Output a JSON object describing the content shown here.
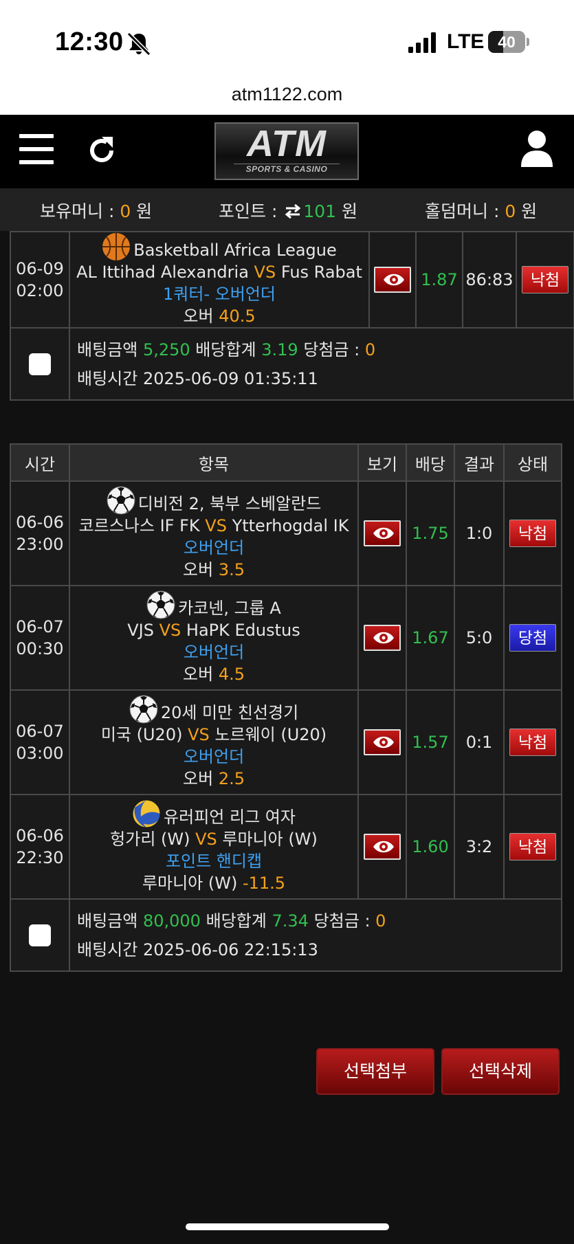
{
  "status_bar": {
    "time": "12:30",
    "network": "LTE",
    "battery": "40",
    "battery_level": 0.4
  },
  "browser": {
    "url": "atm1122.com"
  },
  "header": {
    "logo_main": "ATM",
    "logo_sub": "SPORTS & CASINO"
  },
  "balance": {
    "money_label": "보유머니 : ",
    "money_value": "0",
    "money_unit": " 원",
    "point_label": "포인트 : ",
    "point_value": "101",
    "point_unit": " 원",
    "holdem_label": "홀덤머니 : ",
    "holdem_value": "0",
    "holdem_unit": " 원"
  },
  "slip1": {
    "rows": [
      {
        "date": "06-09",
        "time": "02:00",
        "sport_icon": "basketball-icon",
        "league": "Basketball Africa League",
        "home": "AL Ittihad Alexandria",
        "vs": "VS",
        "away": "Fus Rabat",
        "market": "1쿼터- 오버언더",
        "pick": "오버",
        "line": "40.5",
        "odds": "1.87",
        "result": "86:83",
        "status": "낙첨"
      }
    ],
    "summary": {
      "amount_label": "배팅금액 ",
      "amount": "5,250",
      "total_label": " 배당합계 ",
      "total": "3.19",
      "payout_label": " 당첨금 : ",
      "payout": "0",
      "time_label": "배팅시간 ",
      "time": "2025-06-09 01:35:11"
    }
  },
  "slip2": {
    "headers": [
      "시간",
      "항목",
      "보기",
      "배당",
      "결과",
      "상태"
    ],
    "rows": [
      {
        "date": "06-06",
        "time": "23:00",
        "sport_icon": "soccer-ball-icon",
        "league": "디비전 2, 북부 스베알란드",
        "home": "코르스나스 IF FK",
        "vs": "VS",
        "away": "Ytterhogdal IK",
        "market": "오버언더",
        "pick": "오버",
        "line": "3.5",
        "odds": "1.75",
        "result": "1:0",
        "status": "낙첨"
      },
      {
        "date": "06-07",
        "time": "00:30",
        "sport_icon": "soccer-ball-icon",
        "league": "카코넨, 그룹 A",
        "home": "VJS",
        "vs": "VS",
        "away": "HaPK Edustus",
        "market": "오버언더",
        "pick": "오버",
        "line": "4.5",
        "odds": "1.67",
        "result": "5:0",
        "status": "당첨"
      },
      {
        "date": "06-07",
        "time": "03:00",
        "sport_icon": "soccer-ball-icon",
        "league": "20세 미만 친선경기",
        "home": "미국 (U20)",
        "vs": "VS",
        "away": "노르웨이 (U20)",
        "market": "오버언더",
        "pick": "오버",
        "line": "2.5",
        "odds": "1.57",
        "result": "0:1",
        "status": "낙첨"
      },
      {
        "date": "06-06",
        "time": "22:30",
        "sport_icon": "volleyball-icon",
        "league": "유러피언 리그 여자",
        "home": "헝가리 (W)",
        "vs": "VS",
        "away": "루마니아 (W)",
        "market": "포인트 핸디캡",
        "pick": "루마니아 (W)",
        "line": "-11.5",
        "odds": "1.60",
        "result": "3:2",
        "status": "낙첨"
      }
    ],
    "summary": {
      "amount_label": "배팅금액 ",
      "amount": "80,000",
      "total_label": " 배당합계 ",
      "total": "7.34",
      "payout_label": " 당첨금 : ",
      "payout": "0",
      "time_label": "배팅시간 ",
      "time": "2025-06-06 22:15:13"
    }
  },
  "actions": {
    "attach_label": "선택첨부",
    "delete_label": "선택삭제"
  },
  "colors": {
    "accent_orange": "#f5a11a",
    "odds_green": "#31c04f",
    "market_blue": "#3ea0f0",
    "lose_red": "#c81f1f",
    "win_blue": "#2a2ad0"
  }
}
